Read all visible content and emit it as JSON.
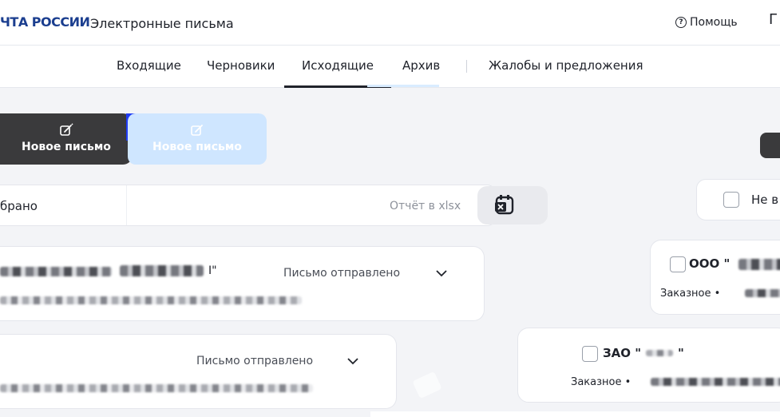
{
  "header": {
    "brand": "ЧТА РОССИИ",
    "title": "Электронные письма",
    "help_label": "Помощь",
    "right_cut": "Г"
  },
  "tabs": [
    {
      "label": "Входящие",
      "active": false
    },
    {
      "label": "Черновики",
      "active": false
    },
    {
      "label": "Исходящие",
      "active": true
    },
    {
      "label": "Архив",
      "active": false
    },
    {
      "label": "Жалобы и предложения",
      "active": false
    }
  ],
  "actions": {
    "new_letter": "Новое письмо",
    "new_letter_ghost": "Новое письмо"
  },
  "filter": {
    "selected_label": "брано",
    "report_label": "Отчёт в xlsx",
    "not_selected_label": "Не в"
  },
  "letters": [
    {
      "status": "Письмо отправлено"
    },
    {
      "status": "Письмо отправлено"
    }
  ],
  "recipients": [
    {
      "org": "ООО \"",
      "type": "Заказное •"
    },
    {
      "org": "ЗАО \"",
      "type": "Заказное •",
      "org_suffix": "\""
    }
  ],
  "colors": {
    "dark_button": "#3a3a3c",
    "ghost_button": "#cfe6ff",
    "accent_blue": "#1f3cf5",
    "brand_blue": "#1b3e8f"
  }
}
